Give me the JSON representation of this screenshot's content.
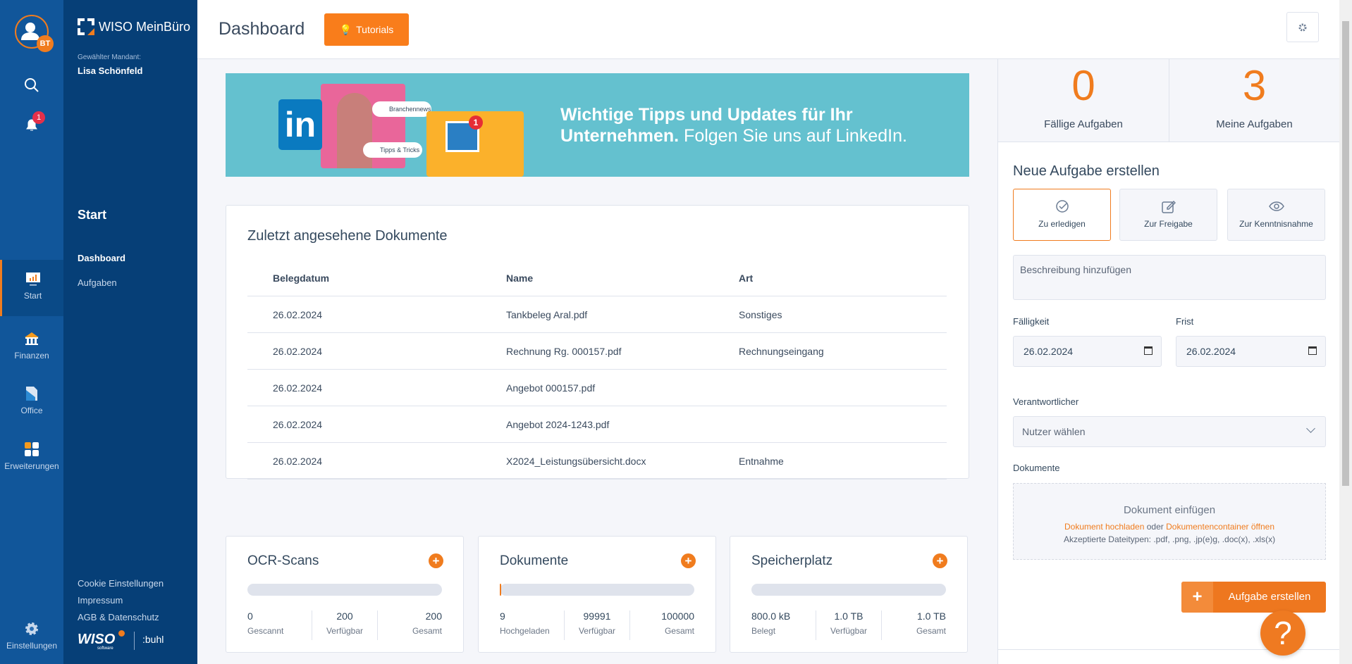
{
  "rail": {
    "avatar_initials": "BT",
    "notification_count": "1",
    "items": [
      {
        "label": "Start",
        "icon": "chart-icon"
      },
      {
        "label": "Finanzen",
        "icon": "bank-icon"
      },
      {
        "label": "Office",
        "icon": "document-icon"
      },
      {
        "label": "Erweiterungen",
        "icon": "apps-icon"
      }
    ],
    "settings_label": "Einstellungen"
  },
  "nav": {
    "brand": "WISO MeinBüro",
    "client_label": "Gewählter Mandant:",
    "client_name": "Lisa Schönfeld",
    "section": "Start",
    "items": [
      "Dashboard",
      "Aufgaben"
    ],
    "footer_links": [
      "Cookie Einstellungen",
      "Impressum",
      "AGB & Datenschutz"
    ],
    "logo_wiso": "WISO",
    "logo_software": "software",
    "logo_buhl": ":buhl"
  },
  "header": {
    "title": "Dashboard",
    "tutorials_label": "Tutorials"
  },
  "banner": {
    "headline_bold": "Wichtige Tipps und Updates für Ihr Unternehmen.",
    "headline_light": "Folgen Sie uns auf LinkedIn.",
    "tag1": "Branchennews",
    "tag2": "Tipps & Tricks",
    "badge": "1"
  },
  "recent_docs": {
    "title": "Zuletzt angesehene Dokumente",
    "columns": [
      "Belegdatum",
      "Name",
      "Art"
    ],
    "rows": [
      [
        "26.02.2024",
        "Tankbeleg Aral.pdf",
        "Sonstiges"
      ],
      [
        "26.02.2024",
        "Rechnung Rg. 000157.pdf",
        "Rechnungseingang"
      ],
      [
        "26.02.2024",
        "Angebot 000157.pdf",
        ""
      ],
      [
        "26.02.2024",
        "Angebot 2024-1243.pdf",
        ""
      ],
      [
        "26.02.2024",
        "X2024_Leistungsübersicht.docx",
        "Entnahme"
      ]
    ]
  },
  "stats": [
    {
      "title": "OCR-Scans",
      "progress": 0,
      "cols": [
        [
          "0",
          "Gescannt"
        ],
        [
          "200",
          "Verfügbar"
        ],
        [
          "200",
          "Gesamt"
        ]
      ]
    },
    {
      "title": "Dokumente",
      "progress": 0.009,
      "cols": [
        [
          "9",
          "Hochgeladen"
        ],
        [
          "99991",
          "Verfügbar"
        ],
        [
          "100000",
          "Gesamt"
        ]
      ]
    },
    {
      "title": "Speicherplatz",
      "progress": 0,
      "cols": [
        [
          "800.0 kB",
          "Belegt"
        ],
        [
          "1.0 TB",
          "Verfügbar"
        ],
        [
          "1.0 TB",
          "Gesamt"
        ]
      ]
    }
  ],
  "tasks": {
    "due_count": "0",
    "due_label": "Fällige Aufgaben",
    "mine_count": "3",
    "mine_label": "Meine Aufgaben",
    "new_title": "Neue Aufgabe erstellen",
    "types": [
      "Zu erledigen",
      "Zur Freigabe",
      "Zur Kenntnisnahme"
    ],
    "selected_type": "Zu erledigen",
    "description_placeholder": "Beschreibung hinzufügen",
    "due_label2": "Fälligkeit",
    "due_value": "26.02.2024",
    "deadline_label": "Frist",
    "deadline_value": "26.02.2024",
    "owner_label": "Verantwortlicher",
    "owner_placeholder": "Nutzer wählen",
    "docs_label": "Dokumente",
    "drop_title": "Dokument einfügen",
    "upload_link": "Dokument hochladen",
    "or": "oder",
    "container_link": "Dokumentencontainer öffnen",
    "accepted": "Akzeptierte Dateitypen: .pdf, .png, .jp(e)g, .doc(x), .xls(x)",
    "create_label": "Aufgabe erstellen"
  },
  "help_label": "?",
  "colors": {
    "accent": "#f07c1e",
    "rail": "#11569a",
    "nav": "#063f77",
    "banner": "#64c1cf"
  }
}
